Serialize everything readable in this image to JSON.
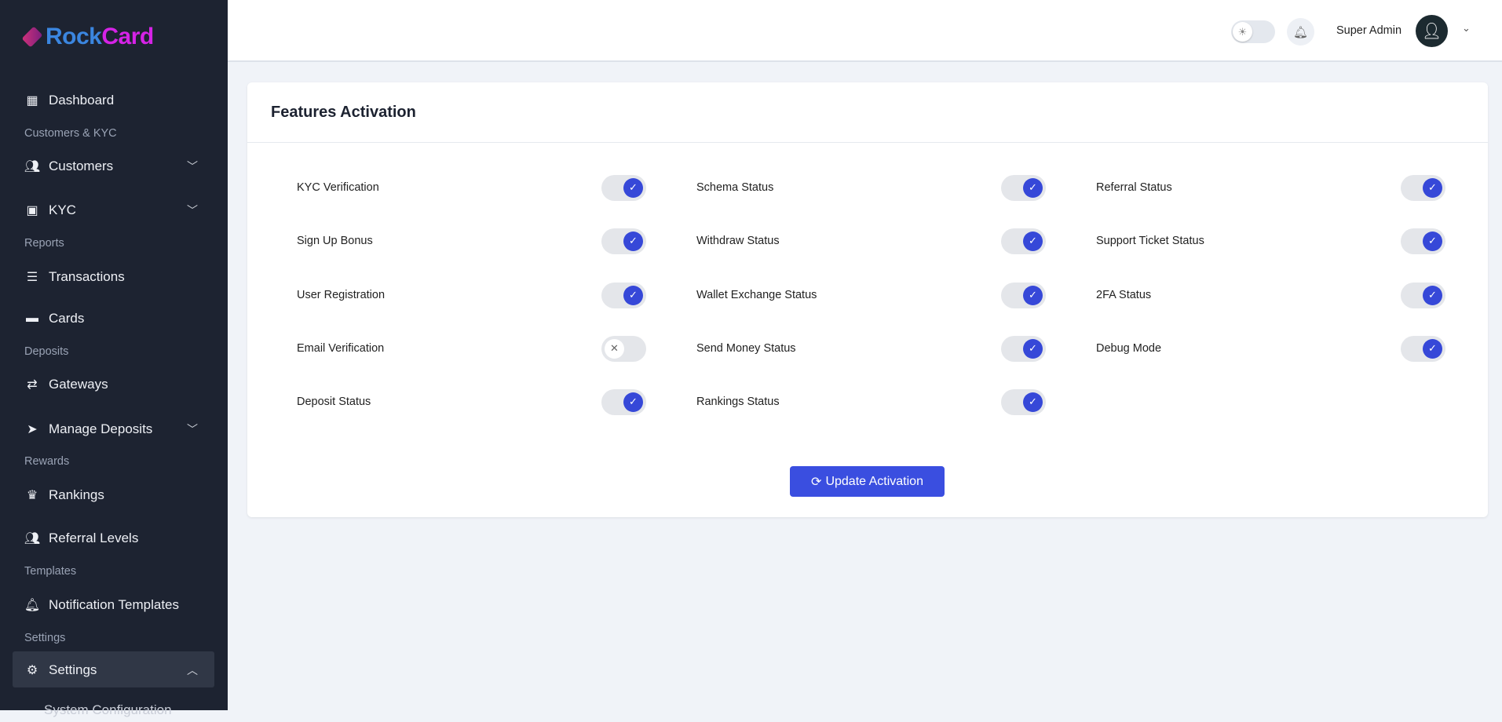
{
  "brand": {
    "part1": "Rock",
    "part2": "Card"
  },
  "sidebar": {
    "items": [
      {
        "label": "Dashboard",
        "icon": "grid-icon",
        "kind": "item"
      },
      {
        "label": "Customers & KYC",
        "kind": "section"
      },
      {
        "label": "Customers",
        "icon": "users-icon",
        "kind": "item",
        "chevron": "down"
      },
      {
        "label": "KYC",
        "icon": "id-card-icon",
        "kind": "item",
        "chevron": "down"
      },
      {
        "label": "Reports",
        "kind": "section"
      },
      {
        "label": "Transactions",
        "icon": "list-icon",
        "kind": "item"
      },
      {
        "label": "Cards",
        "icon": "credit-card-icon",
        "kind": "item"
      },
      {
        "label": "Deposits",
        "kind": "section"
      },
      {
        "label": "Gateways",
        "icon": "exchange-icon",
        "kind": "item"
      },
      {
        "label": "Manage Deposits",
        "icon": "send-icon",
        "kind": "item",
        "chevron": "down"
      },
      {
        "label": "Rewards",
        "kind": "section"
      },
      {
        "label": "Rankings",
        "icon": "crown-icon",
        "kind": "item"
      },
      {
        "label": "Referral Levels",
        "icon": "users-icon",
        "kind": "item"
      },
      {
        "label": "Templates",
        "kind": "section"
      },
      {
        "label": "Notification Templates",
        "icon": "bell-icon",
        "kind": "item"
      },
      {
        "label": "Settings",
        "kind": "section"
      },
      {
        "label": "Settings",
        "icon": "gear-icon",
        "kind": "item",
        "chevron": "up",
        "active": true
      },
      {
        "label": "System Configuration",
        "kind": "sub"
      }
    ]
  },
  "header": {
    "user_name": "Super Admin"
  },
  "panel": {
    "title": "Features Activation",
    "features": [
      {
        "label": "KYC Verification",
        "on": true
      },
      {
        "label": "Sign Up Bonus",
        "on": true
      },
      {
        "label": "User Registration",
        "on": true
      },
      {
        "label": "Email Verification",
        "on": false
      },
      {
        "label": "Deposit Status",
        "on": true
      },
      {
        "label": "Schema Status",
        "on": true
      },
      {
        "label": "Withdraw Status",
        "on": true
      },
      {
        "label": "Wallet Exchange Status",
        "on": true
      },
      {
        "label": "Send Money Status",
        "on": true
      },
      {
        "label": "Rankings Status",
        "on": true
      },
      {
        "label": "Referral Status",
        "on": true
      },
      {
        "label": "Support Ticket Status",
        "on": true
      },
      {
        "label": "2FA Status",
        "on": true
      },
      {
        "label": "Debug Mode",
        "on": true
      }
    ],
    "submit_label": "Update Activation"
  },
  "colors": {
    "accent": "#3a4ee0",
    "sidebar_bg": "#1d2331"
  }
}
